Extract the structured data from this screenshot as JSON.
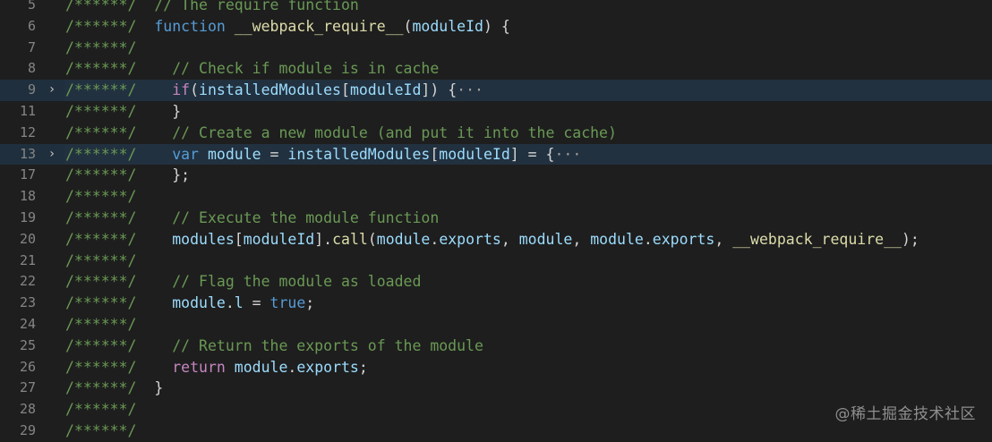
{
  "editor": {
    "lines": [
      {
        "num": "5",
        "fold": "",
        "highlight": false,
        "tokens": [
          {
            "t": "/******/",
            "c": "comment"
          },
          {
            "t": "  "
          },
          {
            "t": "// The require function",
            "c": "comment"
          }
        ]
      },
      {
        "num": "6",
        "fold": "",
        "highlight": false,
        "tokens": [
          {
            "t": "/******/",
            "c": "comment"
          },
          {
            "t": "  "
          },
          {
            "t": "function",
            "c": "keyword"
          },
          {
            "t": " "
          },
          {
            "t": "__webpack_require__",
            "c": "func"
          },
          {
            "t": "("
          },
          {
            "t": "moduleId",
            "c": "var"
          },
          {
            "t": ") {"
          }
        ]
      },
      {
        "num": "7",
        "fold": "",
        "highlight": false,
        "tokens": [
          {
            "t": "/******/",
            "c": "comment"
          }
        ]
      },
      {
        "num": "8",
        "fold": "",
        "highlight": false,
        "tokens": [
          {
            "t": "/******/",
            "c": "comment"
          },
          {
            "t": "    "
          },
          {
            "t": "// Check if module is in cache",
            "c": "comment"
          }
        ]
      },
      {
        "num": "9",
        "fold": "›",
        "highlight": true,
        "tokens": [
          {
            "t": "/******/",
            "c": "comment"
          },
          {
            "t": "    "
          },
          {
            "t": "if",
            "c": "control"
          },
          {
            "t": "("
          },
          {
            "t": "installedModules",
            "c": "var"
          },
          {
            "t": "["
          },
          {
            "t": "moduleId",
            "c": "var"
          },
          {
            "t": "]) {"
          },
          {
            "t": "···",
            "c": "ellipsis"
          }
        ]
      },
      {
        "num": "11",
        "fold": "",
        "highlight": false,
        "tokens": [
          {
            "t": "/******/",
            "c": "comment"
          },
          {
            "t": "    }"
          }
        ]
      },
      {
        "num": "12",
        "fold": "",
        "highlight": false,
        "tokens": [
          {
            "t": "/******/",
            "c": "comment"
          },
          {
            "t": "    "
          },
          {
            "t": "// Create a new module (and put it into the cache)",
            "c": "comment"
          }
        ]
      },
      {
        "num": "13",
        "fold": "›",
        "highlight": true,
        "tokens": [
          {
            "t": "/******/",
            "c": "comment"
          },
          {
            "t": "    "
          },
          {
            "t": "var",
            "c": "keyword"
          },
          {
            "t": " "
          },
          {
            "t": "module",
            "c": "var"
          },
          {
            "t": " = "
          },
          {
            "t": "installedModules",
            "c": "var"
          },
          {
            "t": "["
          },
          {
            "t": "moduleId",
            "c": "var"
          },
          {
            "t": "] = {"
          },
          {
            "t": "···",
            "c": "ellipsis"
          }
        ]
      },
      {
        "num": "17",
        "fold": "",
        "highlight": false,
        "tokens": [
          {
            "t": "/******/",
            "c": "comment"
          },
          {
            "t": "    };"
          }
        ]
      },
      {
        "num": "18",
        "fold": "",
        "highlight": false,
        "tokens": [
          {
            "t": "/******/",
            "c": "comment"
          }
        ]
      },
      {
        "num": "19",
        "fold": "",
        "highlight": false,
        "tokens": [
          {
            "t": "/******/",
            "c": "comment"
          },
          {
            "t": "    "
          },
          {
            "t": "// Execute the module function",
            "c": "comment"
          }
        ]
      },
      {
        "num": "20",
        "fold": "",
        "highlight": false,
        "tokens": [
          {
            "t": "/******/",
            "c": "comment"
          },
          {
            "t": "    "
          },
          {
            "t": "modules",
            "c": "var"
          },
          {
            "t": "["
          },
          {
            "t": "moduleId",
            "c": "var"
          },
          {
            "t": "]."
          },
          {
            "t": "call",
            "c": "func"
          },
          {
            "t": "("
          },
          {
            "t": "module",
            "c": "var"
          },
          {
            "t": "."
          },
          {
            "t": "exports",
            "c": "var"
          },
          {
            "t": ", "
          },
          {
            "t": "module",
            "c": "var"
          },
          {
            "t": ", "
          },
          {
            "t": "module",
            "c": "var"
          },
          {
            "t": "."
          },
          {
            "t": "exports",
            "c": "var"
          },
          {
            "t": ", "
          },
          {
            "t": "__webpack_require__",
            "c": "func"
          },
          {
            "t": ");"
          }
        ]
      },
      {
        "num": "21",
        "fold": "",
        "highlight": false,
        "tokens": [
          {
            "t": "/******/",
            "c": "comment"
          }
        ]
      },
      {
        "num": "22",
        "fold": "",
        "highlight": false,
        "tokens": [
          {
            "t": "/******/",
            "c": "comment"
          },
          {
            "t": "    "
          },
          {
            "t": "// Flag the module as loaded",
            "c": "comment"
          }
        ]
      },
      {
        "num": "23",
        "fold": "",
        "highlight": false,
        "tokens": [
          {
            "t": "/******/",
            "c": "comment"
          },
          {
            "t": "    "
          },
          {
            "t": "module",
            "c": "var"
          },
          {
            "t": "."
          },
          {
            "t": "l",
            "c": "var"
          },
          {
            "t": " = "
          },
          {
            "t": "true",
            "c": "keyword"
          },
          {
            "t": ";"
          }
        ]
      },
      {
        "num": "24",
        "fold": "",
        "highlight": false,
        "tokens": [
          {
            "t": "/******/",
            "c": "comment"
          }
        ]
      },
      {
        "num": "25",
        "fold": "",
        "highlight": false,
        "tokens": [
          {
            "t": "/******/",
            "c": "comment"
          },
          {
            "t": "    "
          },
          {
            "t": "// Return the exports of the module",
            "c": "comment"
          }
        ]
      },
      {
        "num": "26",
        "fold": "",
        "highlight": false,
        "tokens": [
          {
            "t": "/******/",
            "c": "comment"
          },
          {
            "t": "    "
          },
          {
            "t": "return",
            "c": "control"
          },
          {
            "t": " "
          },
          {
            "t": "module",
            "c": "var"
          },
          {
            "t": "."
          },
          {
            "t": "exports",
            "c": "var"
          },
          {
            "t": ";"
          }
        ]
      },
      {
        "num": "27",
        "fold": "",
        "highlight": false,
        "tokens": [
          {
            "t": "/******/",
            "c": "comment"
          },
          {
            "t": "  }"
          }
        ]
      },
      {
        "num": "28",
        "fold": "",
        "highlight": false,
        "tokens": [
          {
            "t": "/******/",
            "c": "comment"
          }
        ]
      },
      {
        "num": "29",
        "fold": "",
        "highlight": false,
        "tokens": [
          {
            "t": "/******/",
            "c": "comment"
          }
        ]
      }
    ]
  },
  "watermark": "@稀土掘金技术社区",
  "colors": {
    "background": "#1e1e1e",
    "comment": "#6a9955",
    "keyword": "#569cd6",
    "control": "#c586c0",
    "function": "#dcdcaa",
    "variable": "#9cdcfe",
    "line_highlight": "#22313f"
  }
}
